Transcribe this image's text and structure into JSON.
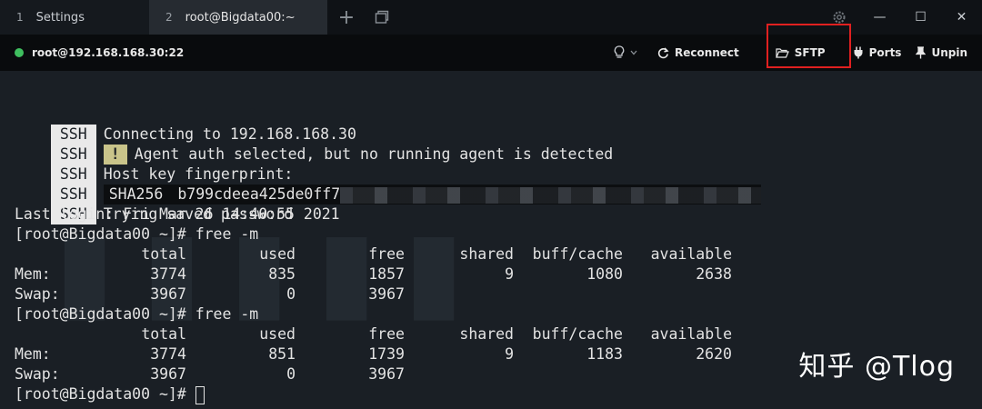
{
  "tabs": [
    {
      "num": "1",
      "label": "Settings"
    },
    {
      "num": "2",
      "label": "root@Bigdata00:~"
    }
  ],
  "tab_add": "+",
  "window": {
    "minimize": "—",
    "maximize": "☐",
    "close": "✕"
  },
  "toolbar": {
    "host": "root@192.168.168.30:22",
    "status_color": "#3fbf5f",
    "reconnect": "Reconnect",
    "sftp": "SFTP",
    "ports": "Ports",
    "unpin": "Unpin",
    "highlight_color": "#e02020"
  },
  "terminal": {
    "ssh_tag": "SSH",
    "connecting": "Connecting to 192.168.168.30",
    "warn_mark": "!",
    "agent_msg": "Agent auth selected, but no running agent is detected",
    "host_key": "Host key fingerprint:",
    "sha_label": "SHA256",
    "fingerprint": "b799cdeea425de0ff7",
    "trying": "Trying saved password",
    "last_login": "Last login: Fri Mar 26 14:40:55 2021",
    "prompt": "[root@Bigdata00 ~]# ",
    "cmd": "free -m",
    "headers": [
      "total",
      "used",
      "free",
      "shared",
      "buff/cache",
      "available"
    ],
    "run1": {
      "mem": {
        "label": "Mem:",
        "values": [
          "3774",
          "835",
          "1857",
          "9",
          "1080",
          "2638"
        ]
      },
      "swap": {
        "label": "Swap:",
        "values": [
          "3967",
          "0",
          "3967"
        ]
      }
    },
    "run2": {
      "mem": {
        "label": "Mem:",
        "values": [
          "3774",
          "851",
          "1739",
          "9",
          "1183",
          "2620"
        ]
      },
      "swap": {
        "label": "Swap:",
        "values": [
          "3967",
          "0",
          "3967"
        ]
      }
    },
    "final_prompt": "[root@Bigdata00 ~]# "
  },
  "watermark": "知乎 @Tlog"
}
